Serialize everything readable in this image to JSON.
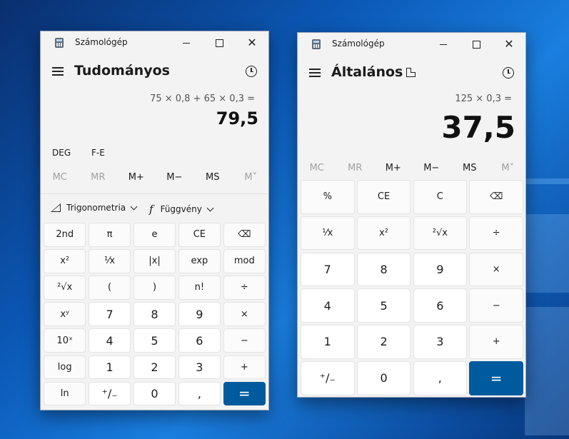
{
  "left": {
    "title": "Számológép",
    "mode": "Tudományos",
    "expression": "75 × 0,8 + 65 × 0,3 =",
    "result": "79,5",
    "deg": "DEG",
    "fe": "F-E",
    "memory": [
      "MC",
      "MR",
      "M+",
      "M−",
      "MS",
      "M˅"
    ],
    "trig_label": "Trigonometria",
    "func_label": "Függvény",
    "keys": [
      [
        "2nd",
        "π",
        "e",
        "CE",
        "⌫"
      ],
      [
        "x²",
        "¹⁄x",
        "|x|",
        "exp",
        "mod"
      ],
      [
        "²√x",
        "(",
        ")",
        "n!",
        "÷"
      ],
      [
        "xʸ",
        "7",
        "8",
        "9",
        "×"
      ],
      [
        "10ˣ",
        "4",
        "5",
        "6",
        "−"
      ],
      [
        "log",
        "1",
        "2",
        "3",
        "+"
      ],
      [
        "ln",
        "⁺∕₋",
        "0",
        ",",
        "="
      ]
    ]
  },
  "right": {
    "title": "Számológép",
    "mode": "Általános",
    "expression": "125 × 0,3 =",
    "result": "37,5",
    "memory": [
      "MC",
      "MR",
      "M+",
      "M−",
      "MS",
      "M˅"
    ],
    "keys": [
      [
        "%",
        "CE",
        "C",
        "⌫"
      ],
      [
        "¹⁄x",
        "x²",
        "²√x",
        "÷"
      ],
      [
        "7",
        "8",
        "9",
        "×"
      ],
      [
        "4",
        "5",
        "6",
        "−"
      ],
      [
        "1",
        "2",
        "3",
        "+"
      ],
      [
        "⁺∕₋",
        "0",
        ",",
        "="
      ]
    ]
  },
  "colors": {
    "accent": "#005a9e",
    "window_bg": "#f3f3f3",
    "desktop": "#0b58b6"
  }
}
